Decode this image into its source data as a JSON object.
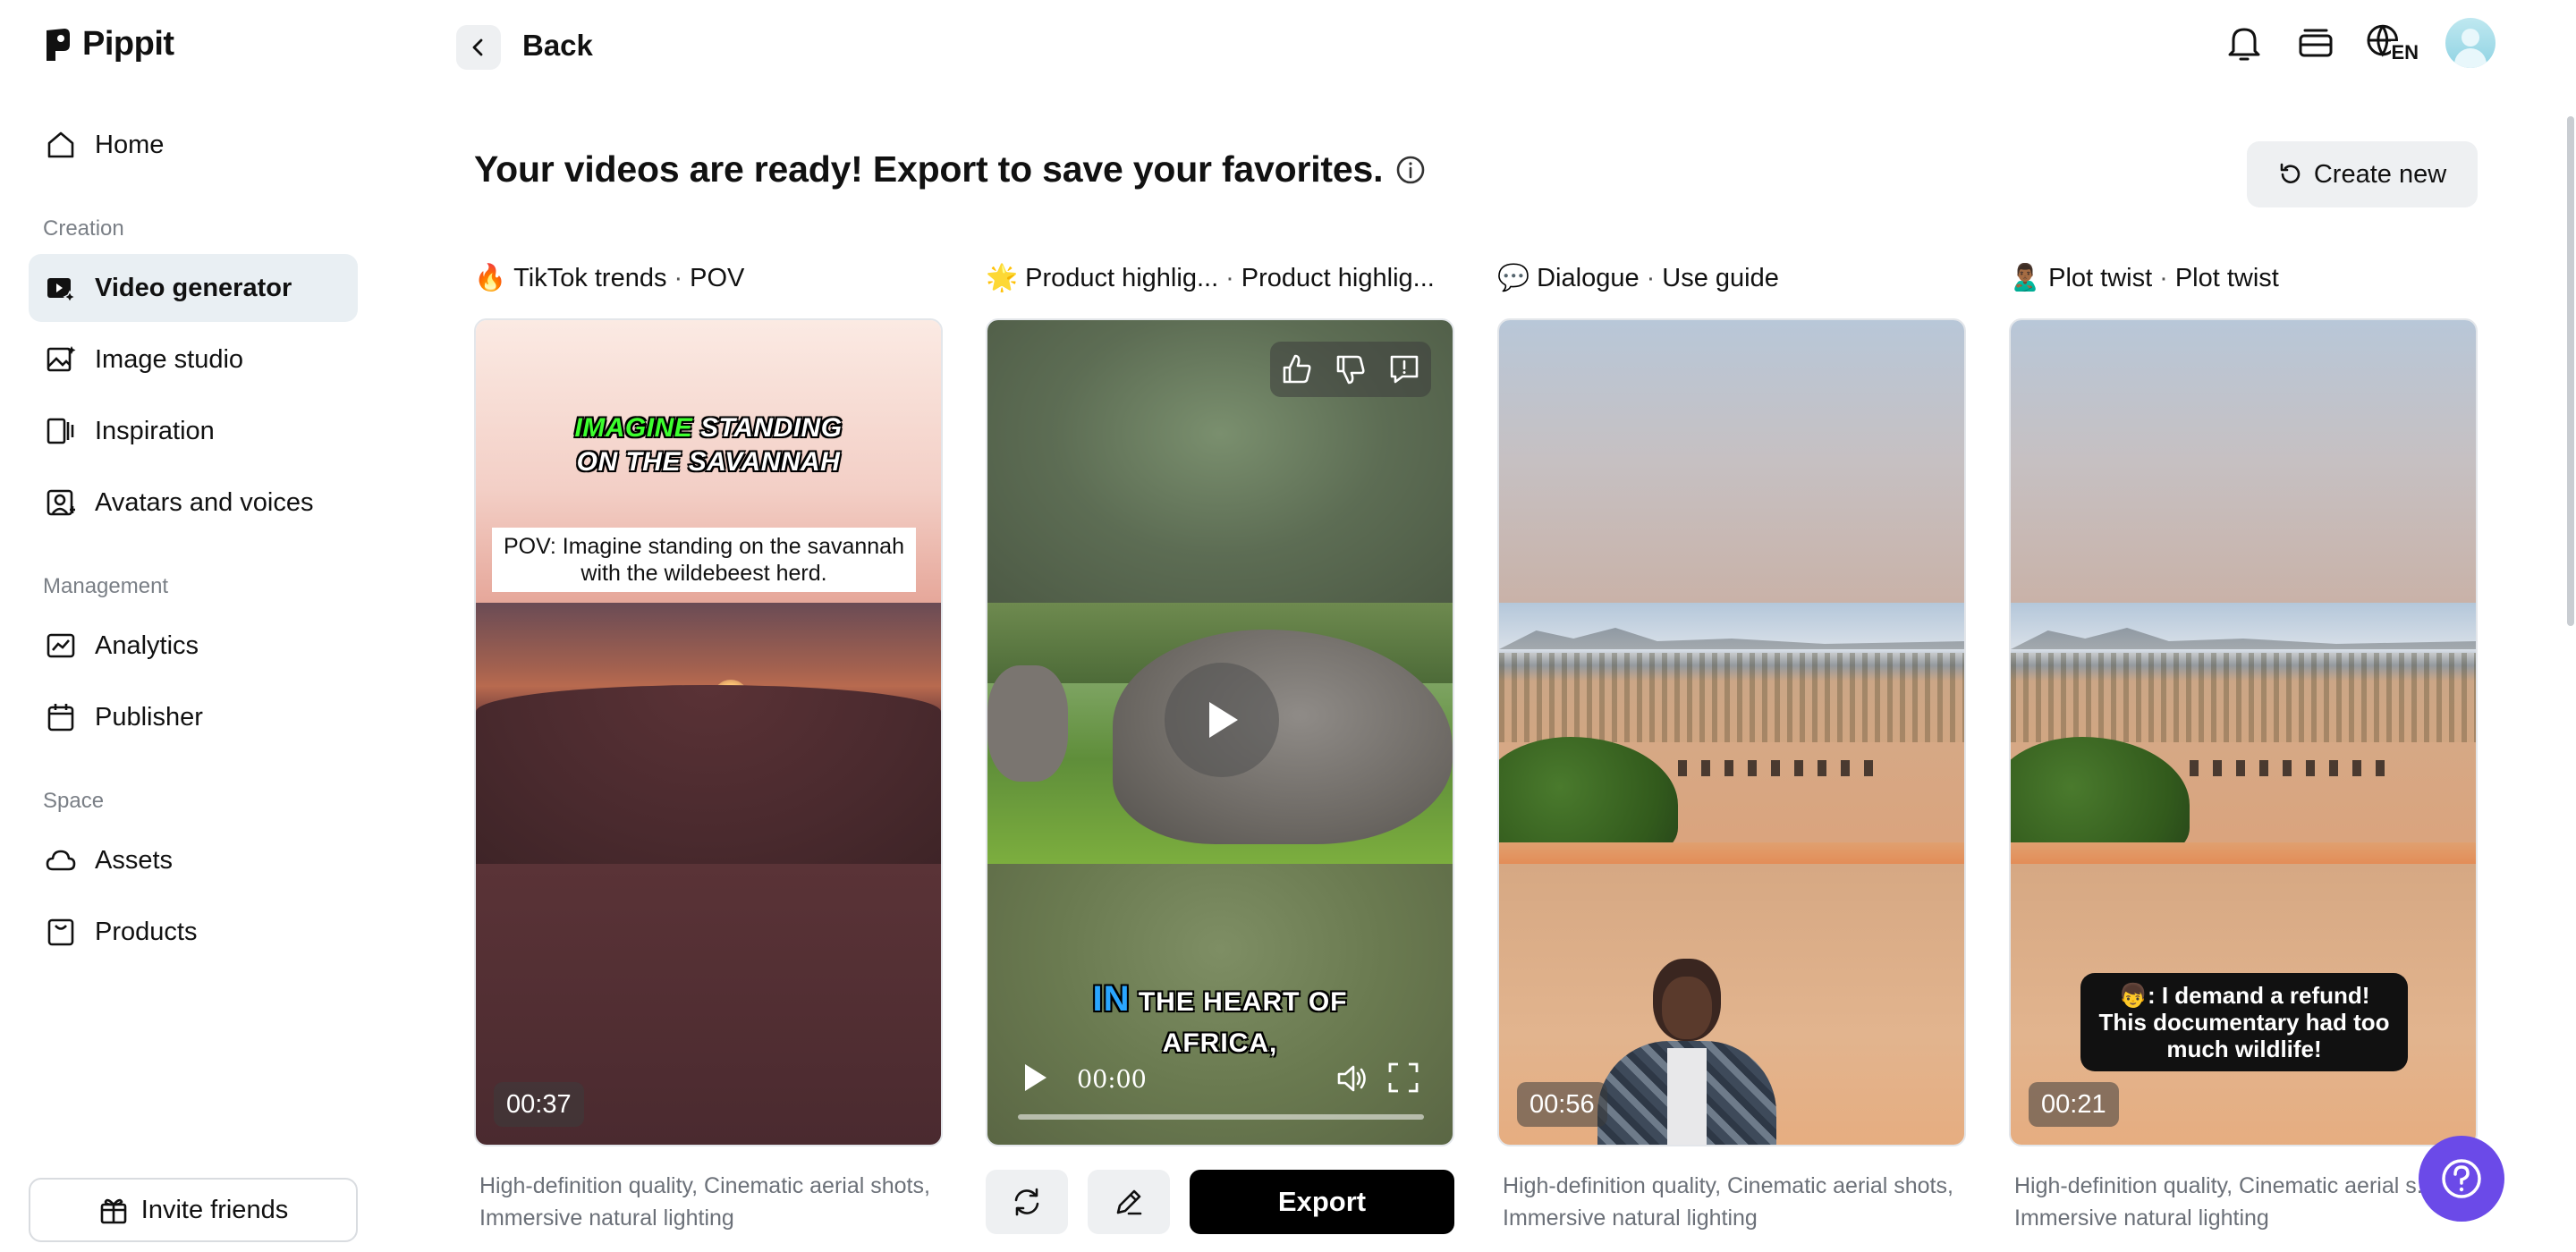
{
  "app": {
    "name": "Pippit"
  },
  "sidebar": {
    "items": [
      {
        "label": "Home",
        "icon": "home-icon"
      },
      {
        "label": "Video generator",
        "icon": "video-generator-icon",
        "active": true
      },
      {
        "label": "Image studio",
        "icon": "image-studio-icon"
      },
      {
        "label": "Inspiration",
        "icon": "inspiration-icon"
      },
      {
        "label": "Avatars and voices",
        "icon": "avatar-icon"
      },
      {
        "label": "Analytics",
        "icon": "analytics-icon"
      },
      {
        "label": "Publisher",
        "icon": "calendar-icon"
      },
      {
        "label": "Assets",
        "icon": "cloud-icon"
      },
      {
        "label": "Products",
        "icon": "product-icon"
      }
    ],
    "sections": {
      "creation": "Creation",
      "management": "Management",
      "space": "Space"
    },
    "invite_label": "Invite friends"
  },
  "header": {
    "back_label": "Back",
    "language": "EN"
  },
  "main": {
    "title": "Your videos are ready! Export to save your favorites.",
    "create_new_label": "Create new",
    "columns": [
      {
        "emoji": "🔥",
        "title_a": "TikTok trends",
        "title_b": "POV",
        "duration": "00:37",
        "headline_green": "IMAGINE",
        "headline_rest": " STANDING",
        "headline_line2": "ON THE SAVANNAH",
        "caption": "POV: Imagine standing on the savannah with the wildebeest herd.",
        "description": "High-definition quality, Cinematic aerial shots, Immersive natural lighting"
      },
      {
        "emoji": "🌟",
        "title_a": "Product highlig...",
        "title_b": "Product highlig...",
        "caption_blue": "IN",
        "caption_rest": " THE HEART OF",
        "caption_line2": "AFRICA,",
        "time": "00:00",
        "export_label": "Export"
      },
      {
        "emoji": "💬",
        "title_a": "Dialogue",
        "title_b": "Use guide",
        "duration": "00:56",
        "description": "High-definition quality, Cinematic aerial shots, Immersive natural lighting"
      },
      {
        "emoji": "🙎🏾‍♂️",
        "title_a": "Plot twist",
        "title_b": "Plot twist",
        "duration": "00:21",
        "bubble": "👦: I demand a refund! This documentary had too much wildlife!",
        "description": "High-definition quality, Cinematic aerial s..., Immersive natural lighting"
      }
    ]
  },
  "colors": {
    "accent_help": "#6b4ae8",
    "active_nav_bg": "#e9eff3",
    "export_bg": "#000000"
  }
}
